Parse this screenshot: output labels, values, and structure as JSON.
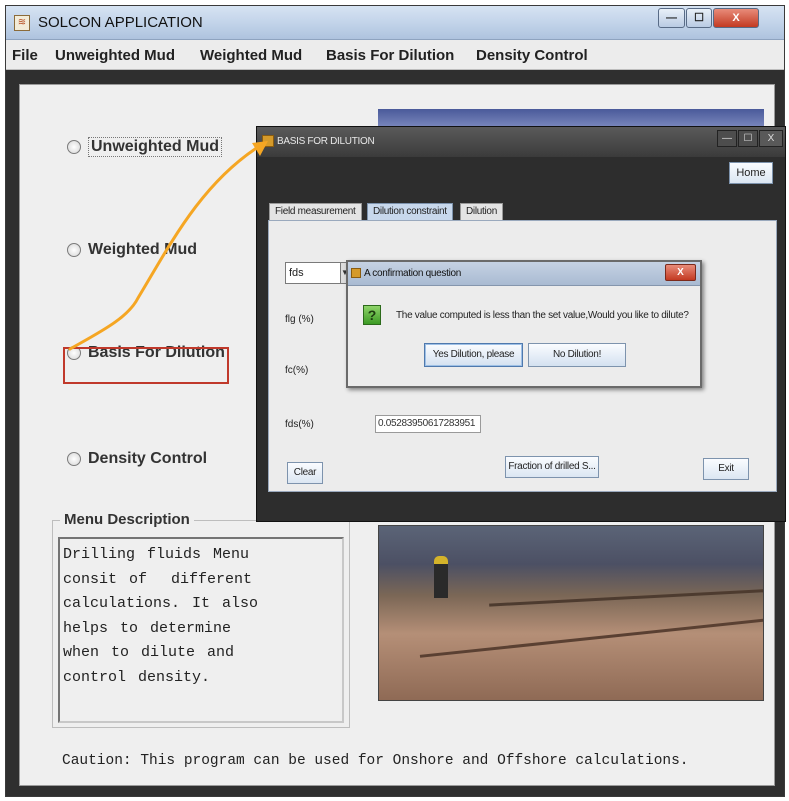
{
  "window": {
    "title": "SOLCON APPLICATION",
    "app_icon_glyph": "≋"
  },
  "window_controls": {
    "minimize": "—",
    "maximize": "☐",
    "close": "X"
  },
  "menubar": {
    "items": [
      "File",
      "Unweighted Mud",
      "Weighted Mud",
      "Basis For Dilution",
      "Density Control"
    ]
  },
  "options": [
    {
      "label": "Unweighted Mud"
    },
    {
      "label": "Weighted Mud"
    },
    {
      "label": "Basis For Dilution"
    },
    {
      "label": "Density Control"
    }
  ],
  "menu_description": {
    "title": "Menu Description",
    "text": "Drilling fluids Menu\nconsit of  different\ncalculations. It also\nhelps to determine\nwhen to dilute and\ncontrol density."
  },
  "caution": "Caution: This program can be used for Onshore and Offshore calculations.",
  "dilution_window": {
    "title": "BASIS FOR DILUTION",
    "controls": {
      "minimize": "—",
      "maximize": "☐",
      "close": "X"
    },
    "home_label": "Home",
    "tabs": [
      "Field measurement",
      "Dilution constraint",
      "Dilution"
    ],
    "active_tab": "Dilution constraint",
    "combo_value": "fds",
    "combo_arrow": "▼",
    "fields": [
      "flg (%)",
      "fc(%)",
      "fds(%)"
    ],
    "fds_value": "0.05283950617283951",
    "clear_label": "Clear",
    "fraction_label": "Fraction of drilled S...",
    "exit_label": "Exit"
  },
  "confirm_dialog": {
    "title": "A confirmation question",
    "close_label": "X",
    "icon_glyph": "?",
    "message": "The value computed is less than the set value,Would you like to dilute?",
    "yes_label": "Yes Dilution, please",
    "no_label": "No Dilution!"
  },
  "colors": {
    "highlight_border": "#c0392b",
    "arrow": "#f5a623"
  }
}
